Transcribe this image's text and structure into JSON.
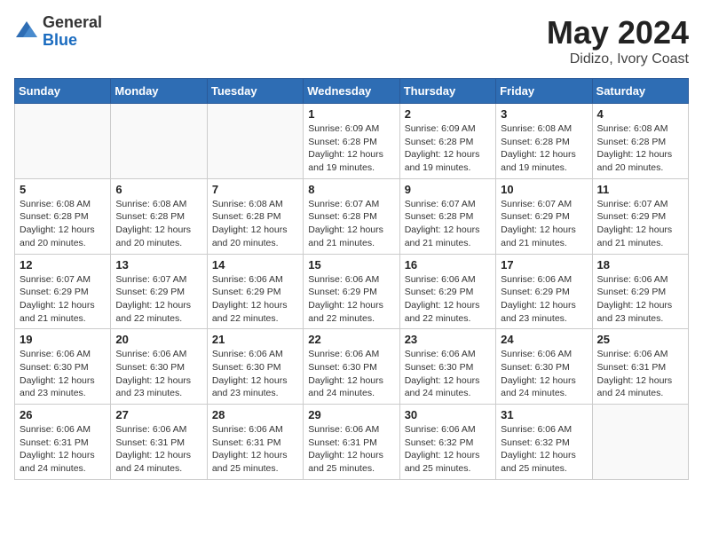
{
  "header": {
    "logo_general": "General",
    "logo_blue": "Blue",
    "title": "May 2024",
    "location": "Didizo, Ivory Coast"
  },
  "weekdays": [
    "Sunday",
    "Monday",
    "Tuesday",
    "Wednesday",
    "Thursday",
    "Friday",
    "Saturday"
  ],
  "weeks": [
    [
      {
        "day": "",
        "info": ""
      },
      {
        "day": "",
        "info": ""
      },
      {
        "day": "",
        "info": ""
      },
      {
        "day": "1",
        "info": "Sunrise: 6:09 AM\nSunset: 6:28 PM\nDaylight: 12 hours\nand 19 minutes."
      },
      {
        "day": "2",
        "info": "Sunrise: 6:09 AM\nSunset: 6:28 PM\nDaylight: 12 hours\nand 19 minutes."
      },
      {
        "day": "3",
        "info": "Sunrise: 6:08 AM\nSunset: 6:28 PM\nDaylight: 12 hours\nand 19 minutes."
      },
      {
        "day": "4",
        "info": "Sunrise: 6:08 AM\nSunset: 6:28 PM\nDaylight: 12 hours\nand 20 minutes."
      }
    ],
    [
      {
        "day": "5",
        "info": "Sunrise: 6:08 AM\nSunset: 6:28 PM\nDaylight: 12 hours\nand 20 minutes."
      },
      {
        "day": "6",
        "info": "Sunrise: 6:08 AM\nSunset: 6:28 PM\nDaylight: 12 hours\nand 20 minutes."
      },
      {
        "day": "7",
        "info": "Sunrise: 6:08 AM\nSunset: 6:28 PM\nDaylight: 12 hours\nand 20 minutes."
      },
      {
        "day": "8",
        "info": "Sunrise: 6:07 AM\nSunset: 6:28 PM\nDaylight: 12 hours\nand 21 minutes."
      },
      {
        "day": "9",
        "info": "Sunrise: 6:07 AM\nSunset: 6:28 PM\nDaylight: 12 hours\nand 21 minutes."
      },
      {
        "day": "10",
        "info": "Sunrise: 6:07 AM\nSunset: 6:29 PM\nDaylight: 12 hours\nand 21 minutes."
      },
      {
        "day": "11",
        "info": "Sunrise: 6:07 AM\nSunset: 6:29 PM\nDaylight: 12 hours\nand 21 minutes."
      }
    ],
    [
      {
        "day": "12",
        "info": "Sunrise: 6:07 AM\nSunset: 6:29 PM\nDaylight: 12 hours\nand 21 minutes."
      },
      {
        "day": "13",
        "info": "Sunrise: 6:07 AM\nSunset: 6:29 PM\nDaylight: 12 hours\nand 22 minutes."
      },
      {
        "day": "14",
        "info": "Sunrise: 6:06 AM\nSunset: 6:29 PM\nDaylight: 12 hours\nand 22 minutes."
      },
      {
        "day": "15",
        "info": "Sunrise: 6:06 AM\nSunset: 6:29 PM\nDaylight: 12 hours\nand 22 minutes."
      },
      {
        "day": "16",
        "info": "Sunrise: 6:06 AM\nSunset: 6:29 PM\nDaylight: 12 hours\nand 22 minutes."
      },
      {
        "day": "17",
        "info": "Sunrise: 6:06 AM\nSunset: 6:29 PM\nDaylight: 12 hours\nand 23 minutes."
      },
      {
        "day": "18",
        "info": "Sunrise: 6:06 AM\nSunset: 6:29 PM\nDaylight: 12 hours\nand 23 minutes."
      }
    ],
    [
      {
        "day": "19",
        "info": "Sunrise: 6:06 AM\nSunset: 6:30 PM\nDaylight: 12 hours\nand 23 minutes."
      },
      {
        "day": "20",
        "info": "Sunrise: 6:06 AM\nSunset: 6:30 PM\nDaylight: 12 hours\nand 23 minutes."
      },
      {
        "day": "21",
        "info": "Sunrise: 6:06 AM\nSunset: 6:30 PM\nDaylight: 12 hours\nand 23 minutes."
      },
      {
        "day": "22",
        "info": "Sunrise: 6:06 AM\nSunset: 6:30 PM\nDaylight: 12 hours\nand 24 minutes."
      },
      {
        "day": "23",
        "info": "Sunrise: 6:06 AM\nSunset: 6:30 PM\nDaylight: 12 hours\nand 24 minutes."
      },
      {
        "day": "24",
        "info": "Sunrise: 6:06 AM\nSunset: 6:30 PM\nDaylight: 12 hours\nand 24 minutes."
      },
      {
        "day": "25",
        "info": "Sunrise: 6:06 AM\nSunset: 6:31 PM\nDaylight: 12 hours\nand 24 minutes."
      }
    ],
    [
      {
        "day": "26",
        "info": "Sunrise: 6:06 AM\nSunset: 6:31 PM\nDaylight: 12 hours\nand 24 minutes."
      },
      {
        "day": "27",
        "info": "Sunrise: 6:06 AM\nSunset: 6:31 PM\nDaylight: 12 hours\nand 24 minutes."
      },
      {
        "day": "28",
        "info": "Sunrise: 6:06 AM\nSunset: 6:31 PM\nDaylight: 12 hours\nand 25 minutes."
      },
      {
        "day": "29",
        "info": "Sunrise: 6:06 AM\nSunset: 6:31 PM\nDaylight: 12 hours\nand 25 minutes."
      },
      {
        "day": "30",
        "info": "Sunrise: 6:06 AM\nSunset: 6:32 PM\nDaylight: 12 hours\nand 25 minutes."
      },
      {
        "day": "31",
        "info": "Sunrise: 6:06 AM\nSunset: 6:32 PM\nDaylight: 12 hours\nand 25 minutes."
      },
      {
        "day": "",
        "info": ""
      }
    ]
  ]
}
